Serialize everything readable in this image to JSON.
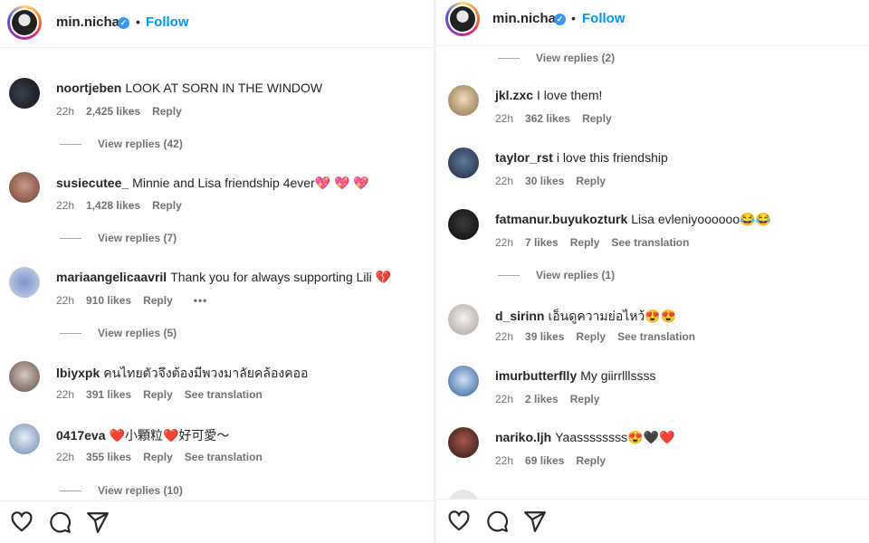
{
  "left": {
    "header": {
      "username": "min.nicha",
      "follow": "Follow",
      "separator": "•"
    },
    "comments": [
      {
        "user": "noortjeben",
        "text": "LOOK AT SORN IN THE WINDOW",
        "time": "22h",
        "likes": "2,425 likes",
        "reply": "Reply",
        "view_replies": "View replies (42)"
      },
      {
        "user": "susiecutee_",
        "text": "Minnie and Lisa friendship 4ever💖 💖 💖",
        "time": "22h",
        "likes": "1,428 likes",
        "reply": "Reply",
        "view_replies": "View replies (7)"
      },
      {
        "user": "mariaangelicaavril",
        "text": "Thank you for always supporting Lili 💔",
        "time": "22h",
        "likes": "910 likes",
        "reply": "Reply",
        "more": "•••",
        "view_replies": "View replies (5)"
      },
      {
        "user": "lbiyxpk",
        "text": "คนไทยตัวจึงต้องมีพวงมาลัยคล้องคออ",
        "time": "22h",
        "likes": "391 likes",
        "reply": "Reply",
        "translation": "See translation"
      },
      {
        "user": "0417eva",
        "text": "❤️小顆粒❤️好可愛～",
        "time": "22h",
        "likes": "355 likes",
        "reply": "Reply",
        "translation": "See translation",
        "view_replies": "View replies (10)"
      }
    ]
  },
  "right": {
    "header": {
      "username": "min.nicha",
      "follow": "Follow",
      "separator": "•"
    },
    "top_view_replies": "View replies (2)",
    "comments": [
      {
        "user": "jkl.zxc",
        "text": "I love them!",
        "time": "22h",
        "likes": "362 likes",
        "reply": "Reply"
      },
      {
        "user": "taylor_rst",
        "text": "i love this friendship",
        "time": "22h",
        "likes": "30 likes",
        "reply": "Reply"
      },
      {
        "user": "fatmanur.buyukozturk",
        "text": "Lisa evleniyoooooo😂😂",
        "time": "22h",
        "likes": "7 likes",
        "reply": "Reply",
        "translation": "See translation",
        "view_replies": "View replies (1)"
      },
      {
        "user": "d_sirinn",
        "text": "เอ็นดูความย่อไหว้😍😍",
        "time": "22h",
        "likes": "39 likes",
        "reply": "Reply",
        "translation": "See translation"
      },
      {
        "user": "imurbutterflly",
        "text": "My giirrlllssss",
        "time": "22h",
        "likes": "2 likes",
        "reply": "Reply"
      },
      {
        "user": "nariko.ljh",
        "text": "Yaassssssss😍🖤❤️",
        "time": "22h",
        "likes": "69 likes",
        "reply": "Reply"
      }
    ]
  },
  "icons": {
    "like": "heart-outline-icon",
    "comment": "comment-bubble-icon",
    "share": "paper-plane-icon",
    "verified": "verified-badge-icon"
  },
  "colors": {
    "link": "#0095f6",
    "verified": "#3897f0",
    "muted": "#737373",
    "text": "#262626"
  }
}
